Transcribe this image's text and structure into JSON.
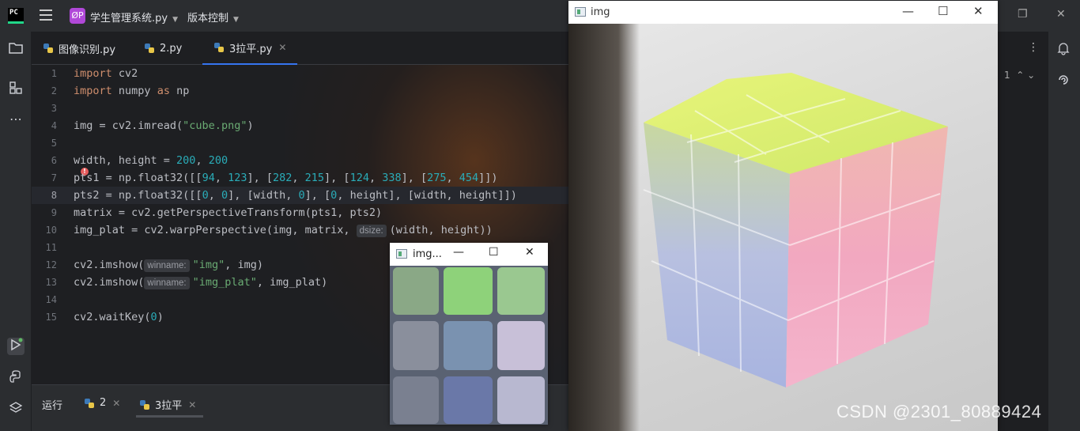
{
  "titlebar": {
    "logo": "PC",
    "project_badge": "ØP",
    "project_name": "学生管理系统.py",
    "vcs_label": "版本控制"
  },
  "tabs": [
    {
      "label": "图像识别.py"
    },
    {
      "label": "2.py"
    },
    {
      "label": "3拉平.py",
      "active": true
    }
  ],
  "editor": {
    "line_numbers": [
      "1",
      "2",
      "3",
      "4",
      "5",
      "6",
      "7",
      "8",
      "9",
      "10",
      "11",
      "12",
      "13",
      "14",
      "15"
    ],
    "current_line": "8",
    "inlay_hints": {
      "dsize": "dsize:",
      "winname1": "winname:",
      "winname2": "winname:"
    }
  },
  "run_panel": {
    "title": "运行",
    "tabs": [
      {
        "label": "2"
      },
      {
        "label": "3拉平"
      }
    ]
  },
  "image_window": {
    "title": "img"
  },
  "small_window": {
    "title": "img..."
  },
  "inspection": {
    "count": "1"
  },
  "watermark": "CSDN @2301_80889424",
  "colors": {
    "accent": "#3574f0",
    "keyword": "#cf8e6d",
    "string": "#6aab73",
    "number": "#2aacb8"
  }
}
